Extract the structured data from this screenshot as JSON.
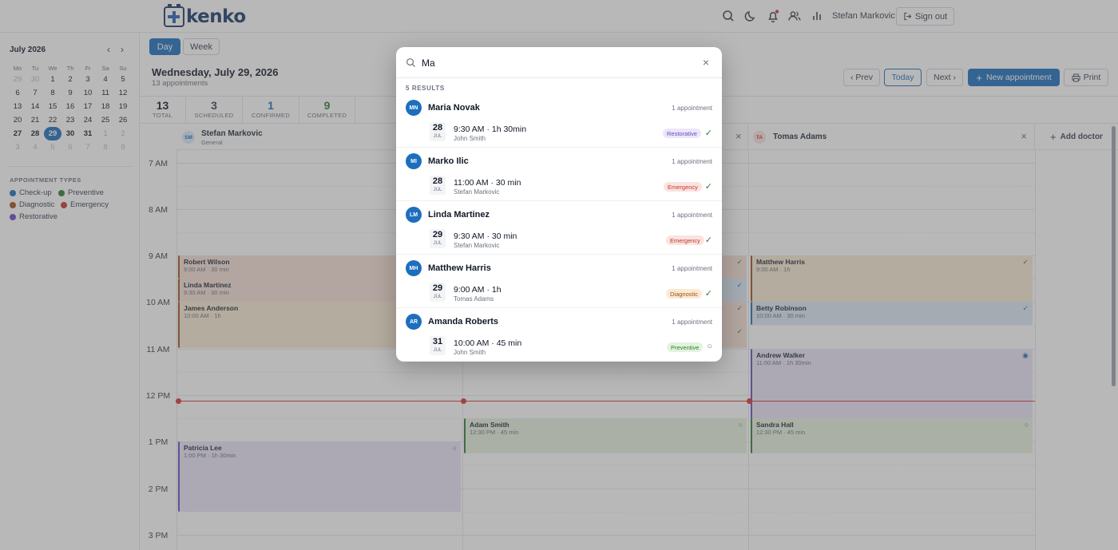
{
  "header": {
    "logo_text": "kenko",
    "user_name": "Stefan Markovic",
    "sign_out_label": "Sign out",
    "icons": [
      "search-icon",
      "moon-icon",
      "bell-icon",
      "users-icon",
      "chart-icon"
    ]
  },
  "mini_calendar": {
    "title": "July 2026",
    "prev": "‹",
    "next": "›",
    "weekdays": [
      "Mo",
      "Tu",
      "We",
      "Th",
      "Fr",
      "Sa",
      "Su"
    ],
    "weeks": [
      [
        "29",
        "30",
        "1",
        "2",
        "3",
        "4",
        "5"
      ],
      [
        "6",
        "7",
        "8",
        "9",
        "10",
        "11",
        "12"
      ],
      [
        "13",
        "14",
        "15",
        "16",
        "17",
        "18",
        "19"
      ],
      [
        "20",
        "21",
        "22",
        "23",
        "24",
        "25",
        "26"
      ],
      [
        "27",
        "28",
        "29",
        "30",
        "31",
        "1",
        "2"
      ],
      [
        "3",
        "4",
        "5",
        "6",
        "7",
        "8",
        "9"
      ]
    ],
    "selected": "29"
  },
  "appointment_types": {
    "title": "APPOINTMENT TYPES",
    "items": [
      {
        "label": "Check-up",
        "color": "#1d6fbe"
      },
      {
        "label": "Preventive",
        "color": "#2e7d32"
      },
      {
        "label": "Diagnostic",
        "color": "#a0521d"
      },
      {
        "label": "Emergency",
        "color": "#c0392b"
      },
      {
        "label": "Restorative",
        "color": "#6c4bc2"
      }
    ]
  },
  "toolbar": {
    "day_label": "Day",
    "week_label": "Week",
    "date_title": "Wednesday, July 29, 2026",
    "date_sub": "13 appointments",
    "prev_label": "‹ Prev",
    "today_label": "Today",
    "next_label": "Next ›",
    "new_label": "New appointment",
    "print_label": "Print"
  },
  "stats": [
    {
      "value": "13",
      "label": "TOTAL",
      "color": "#111827"
    },
    {
      "value": "3",
      "label": "SCHEDULED",
      "color": "#374151"
    },
    {
      "value": "1",
      "label": "CONFIRMED",
      "color": "#1d6fbe"
    },
    {
      "value": "9",
      "label": "COMPLETED",
      "color": "#2e7d32"
    }
  ],
  "columns": [
    {
      "initials": "SM",
      "name": "Stefan Markovic",
      "specialty": "General"
    },
    {
      "initials": "TA",
      "name": "Tomas Adams",
      "close": "×"
    }
  ],
  "add_doctor_label": "Add doctor",
  "hours": [
    "7 AM",
    "8 AM",
    "9 AM",
    "10 AM",
    "11 AM",
    "12 PM",
    "1 PM",
    "2 PM",
    "3 PM"
  ],
  "appointments": [
    {
      "title": "Robert Wilson",
      "sub": "9:00 AM · 30 min"
    },
    {
      "title": "Linda Martinez",
      "sub": "9:30 AM · 30 min"
    },
    {
      "title": "James Anderson",
      "sub": "10:00 AM · 1h"
    },
    {
      "title": "Patricia Lee",
      "sub": "1:00 PM · 1h 30min"
    },
    {
      "title": "Adam Smith",
      "sub": "12:30 PM · 45 min"
    },
    {
      "title": "Matthew Harris",
      "sub": "9:00 AM · 1h"
    },
    {
      "title": "Betty Robinson",
      "sub": "10:00 AM · 30 min"
    },
    {
      "title": "Andrew Walker",
      "sub": "11:00 AM · 1h 30min"
    },
    {
      "title": "Sandra Hall",
      "sub": "12:30 PM · 45 min"
    }
  ],
  "search": {
    "query": "Ma",
    "results_label": "5 RESULTS",
    "results": [
      {
        "initials": "MN",
        "name": "Maria Novak",
        "count": "1 appointment",
        "day": "28",
        "month": "JUL",
        "time": "9:30 AM · 1h 30min",
        "doctor": "John Smith",
        "type": "Restorative",
        "status": "✓"
      },
      {
        "initials": "MI",
        "name": "Marko Ilic",
        "count": "1 appointment",
        "day": "28",
        "month": "JUL",
        "time": "11:00 AM · 30 min",
        "doctor": "Stefan Markovic",
        "type": "Emergency",
        "status": "✓"
      },
      {
        "initials": "LM",
        "name": "Linda Martinez",
        "count": "1 appointment",
        "day": "29",
        "month": "JUL",
        "time": "9:30 AM · 30 min",
        "doctor": "Stefan Markovic",
        "type": "Emergency",
        "status": "✓"
      },
      {
        "initials": "MH",
        "name": "Matthew Harris",
        "count": "1 appointment",
        "day": "29",
        "month": "JUL",
        "time": "9:00 AM · 1h",
        "doctor": "Tomas Adams",
        "type": "Diagnostic",
        "status": "✓"
      },
      {
        "initials": "AR",
        "name": "Amanda Roberts",
        "count": "1 appointment",
        "day": "31",
        "month": "JUL",
        "time": "10:00 AM · 45 min",
        "doctor": "John Smith",
        "type": "Preventive",
        "status": "○"
      }
    ]
  }
}
